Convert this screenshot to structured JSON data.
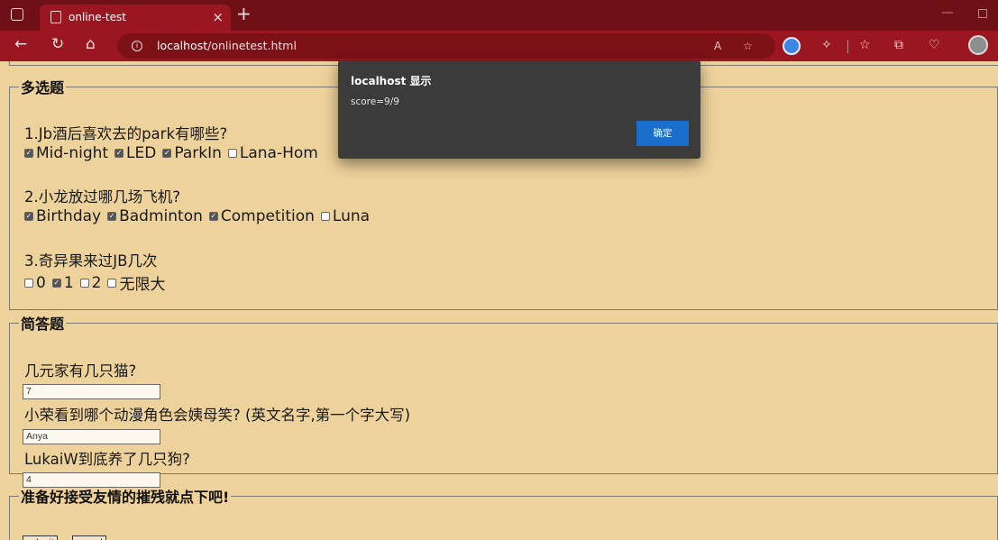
{
  "browser": {
    "tab_title": "online-test",
    "tab_close": "×",
    "new_tab": "+",
    "url_host": "localhost",
    "url_path": "/onlinetest.html"
  },
  "section_multi": {
    "legend": "多选题",
    "questions": [
      {
        "text": "1.Jb酒后喜欢去的park有哪些?",
        "options": [
          {
            "label": "Mid-night",
            "checked": true
          },
          {
            "label": "LED",
            "checked": true
          },
          {
            "label": "ParkIn",
            "checked": true
          },
          {
            "label": "Lana-Hom",
            "checked": false
          }
        ]
      },
      {
        "text": "2.小龙放过哪几场飞机?",
        "options": [
          {
            "label": "Birthday",
            "checked": true
          },
          {
            "label": "Badminton",
            "checked": true
          },
          {
            "label": "Competition",
            "checked": true
          },
          {
            "label": "Luna",
            "checked": false
          }
        ]
      },
      {
        "text": "3.奇异果来过JB几次",
        "options": [
          {
            "label": "0",
            "checked": false
          },
          {
            "label": "1",
            "checked": true
          },
          {
            "label": "2",
            "checked": false
          },
          {
            "label": "无限大",
            "checked": false
          }
        ]
      }
    ]
  },
  "section_short": {
    "legend": "简答题",
    "questions": [
      {
        "text": "几元家有几只猫?",
        "value": "7"
      },
      {
        "text": "小荣看到哪个动漫角色会姨母笑? (英文名字,第一个字大写)",
        "value": "Anya"
      },
      {
        "text": "LukaiW到底养了几只狗?",
        "value": "4"
      }
    ]
  },
  "section_submit": {
    "legend": "准备好接受友情的摧残就点下吧!",
    "submit_label": "submit",
    "record_label": "record"
  },
  "dialog": {
    "title": "localhost 显示",
    "message": "score=9/9",
    "ok_label": "确定"
  }
}
